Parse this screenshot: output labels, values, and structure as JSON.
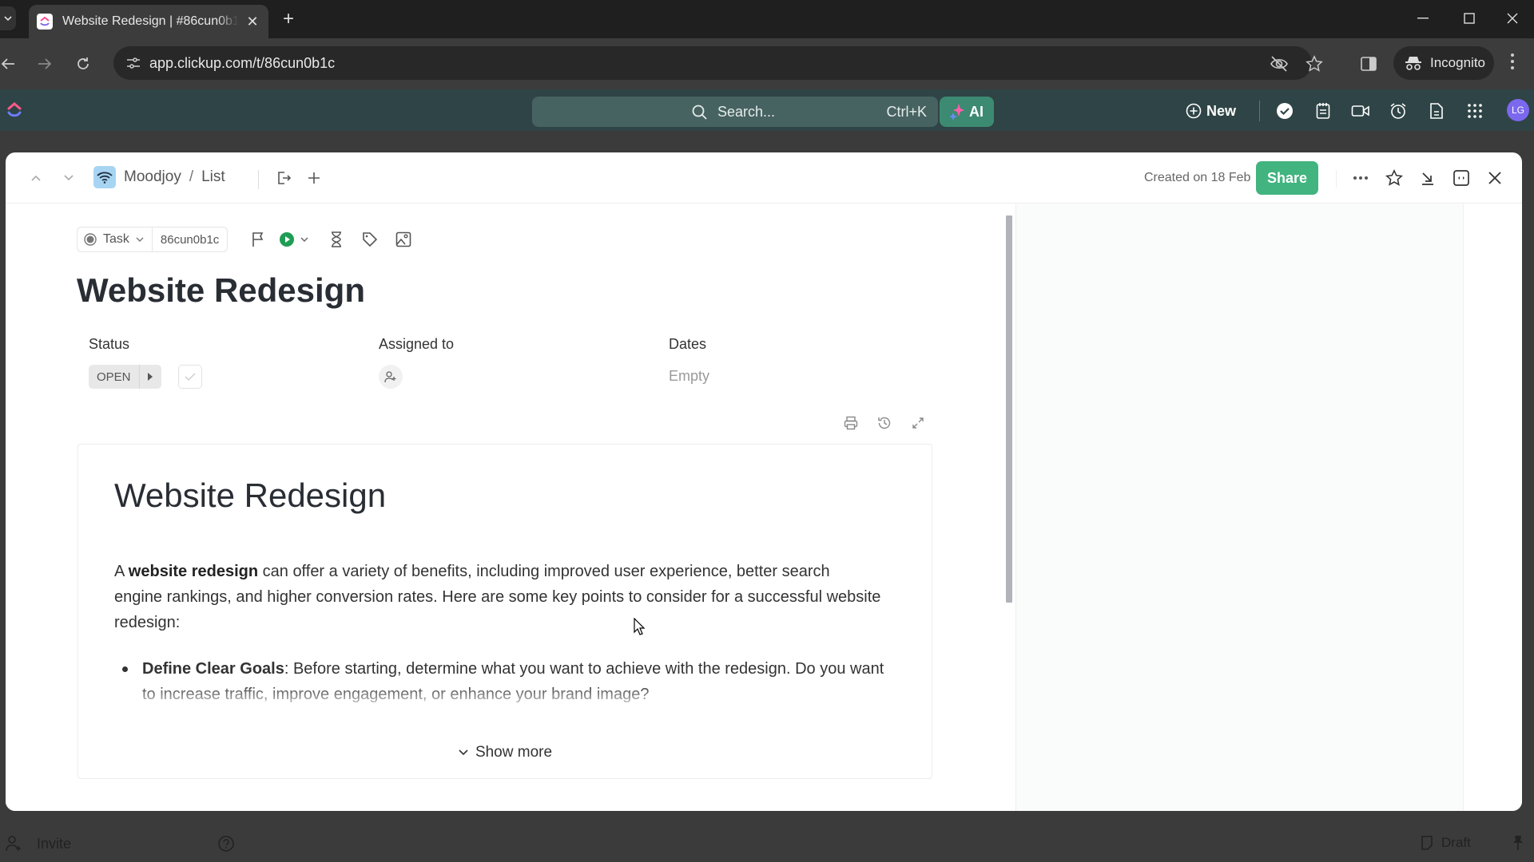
{
  "browser": {
    "tab_title": "Website Redesign | #86cun0b1c",
    "url": "app.clickup.com/t/86cun0b1c",
    "incognito_label": "Incognito"
  },
  "appbar": {
    "search_placeholder": "Search...",
    "search_shortcut": "Ctrl+K",
    "ai_label": "AI",
    "new_label": "New",
    "avatar_initials": "LG",
    "avatar_color": "#7b68ee"
  },
  "modal": {
    "breadcrumb": {
      "space": "Moodjoy",
      "separator": "/",
      "list": "List"
    },
    "created_text": "Created on 18 Feb",
    "share_label": "Share",
    "share_color": "#41b47f"
  },
  "task": {
    "type_label": "Task",
    "task_id": "86cun0b1c",
    "title": "Website Redesign",
    "fields": {
      "status_label": "Status",
      "status_value": "OPEN",
      "assigned_label": "Assigned to",
      "dates_label": "Dates",
      "dates_value": "Empty"
    }
  },
  "doc": {
    "heading": "Website Redesign",
    "intro_prefix": "A ",
    "intro_bold": "website redesign",
    "intro_rest": " can offer a variety of benefits, including improved user experience, better search engine rankings, and higher conversion rates. Here are some key points to consider for a successful website redesign:",
    "bullets": [
      {
        "bold": "Define Clear Goals",
        "text": ": Before starting, determine what you want to achieve with the redesign. Do you want to increase traffic, improve engagement, or enhance your brand image?"
      }
    ],
    "show_more_label": "Show more"
  },
  "bottombar": {
    "invite_label": "Invite",
    "draft_label": "Draft"
  }
}
